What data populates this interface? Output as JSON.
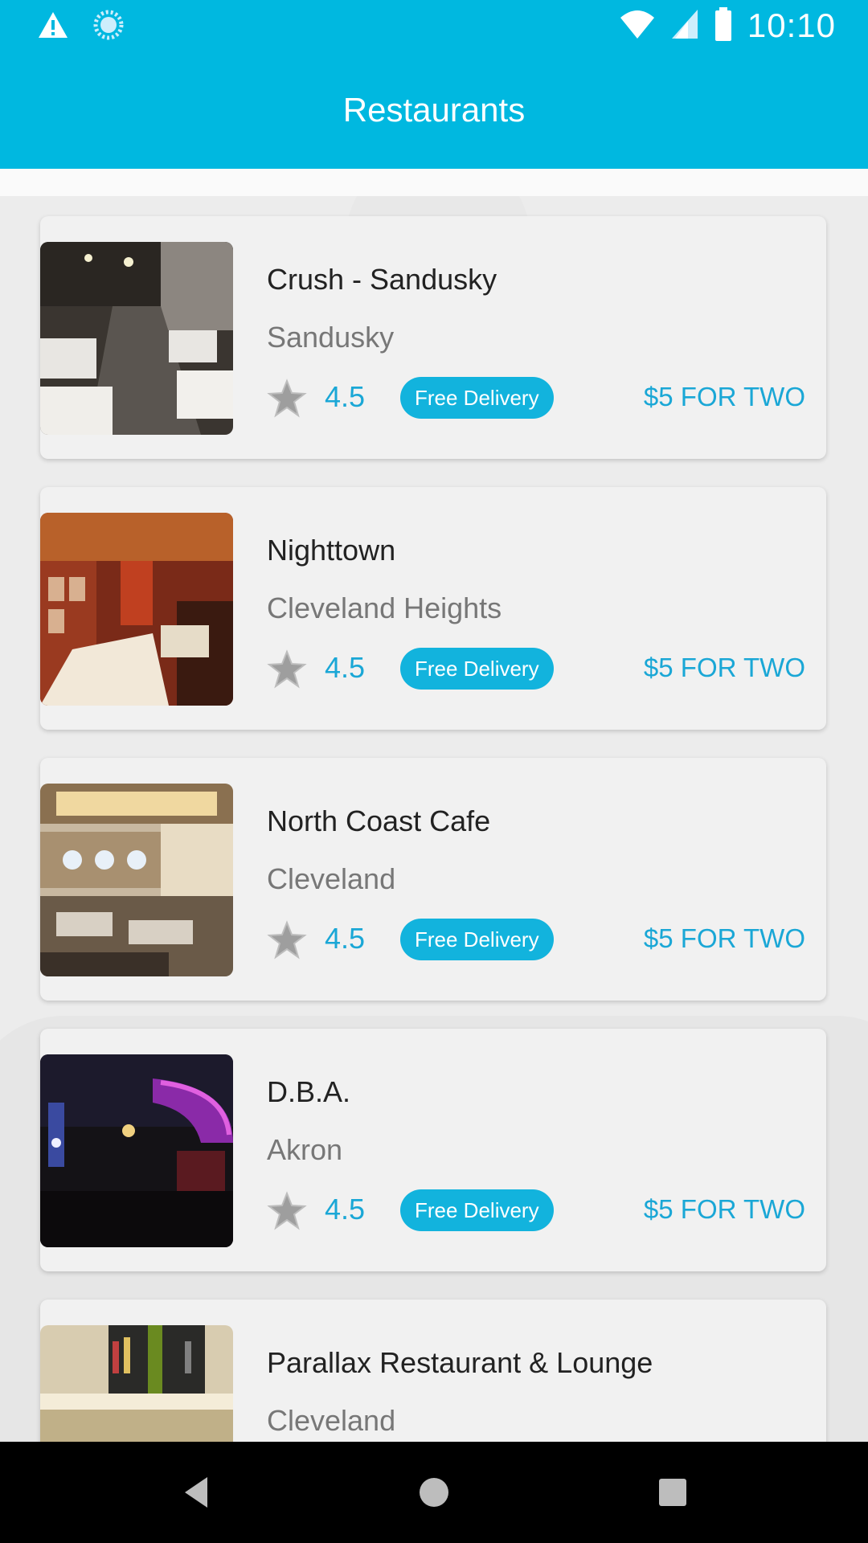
{
  "status_bar": {
    "time": "10:10",
    "icons": [
      "warning-icon",
      "sync-icon",
      "wifi-icon",
      "cell-signal-icon",
      "battery-icon"
    ]
  },
  "header": {
    "title": "Restaurants"
  },
  "restaurants": [
    {
      "name": "Crush - Sandusky",
      "city": "Sandusky",
      "rating": "4.5",
      "badge": "Free Delivery",
      "price": "$5 FOR TWO"
    },
    {
      "name": "Nighttown",
      "city": "Cleveland Heights",
      "rating": "4.5",
      "badge": "Free Delivery",
      "price": "$5 FOR TWO"
    },
    {
      "name": "North Coast Cafe",
      "city": "Cleveland",
      "rating": "4.5",
      "badge": "Free Delivery",
      "price": "$5 FOR TWO"
    },
    {
      "name": "D.B.A.",
      "city": "Akron",
      "rating": "4.5",
      "badge": "Free Delivery",
      "price": "$5 FOR TWO"
    },
    {
      "name": "Parallax Restaurant & Lounge",
      "city": "Cleveland",
      "rating": "",
      "badge": "",
      "price": ""
    }
  ],
  "nav": {
    "buttons": [
      "back-icon",
      "home-icon",
      "recents-icon"
    ]
  },
  "colors": {
    "accent": "#00b8e0",
    "accent_text": "#1aa7d6"
  }
}
